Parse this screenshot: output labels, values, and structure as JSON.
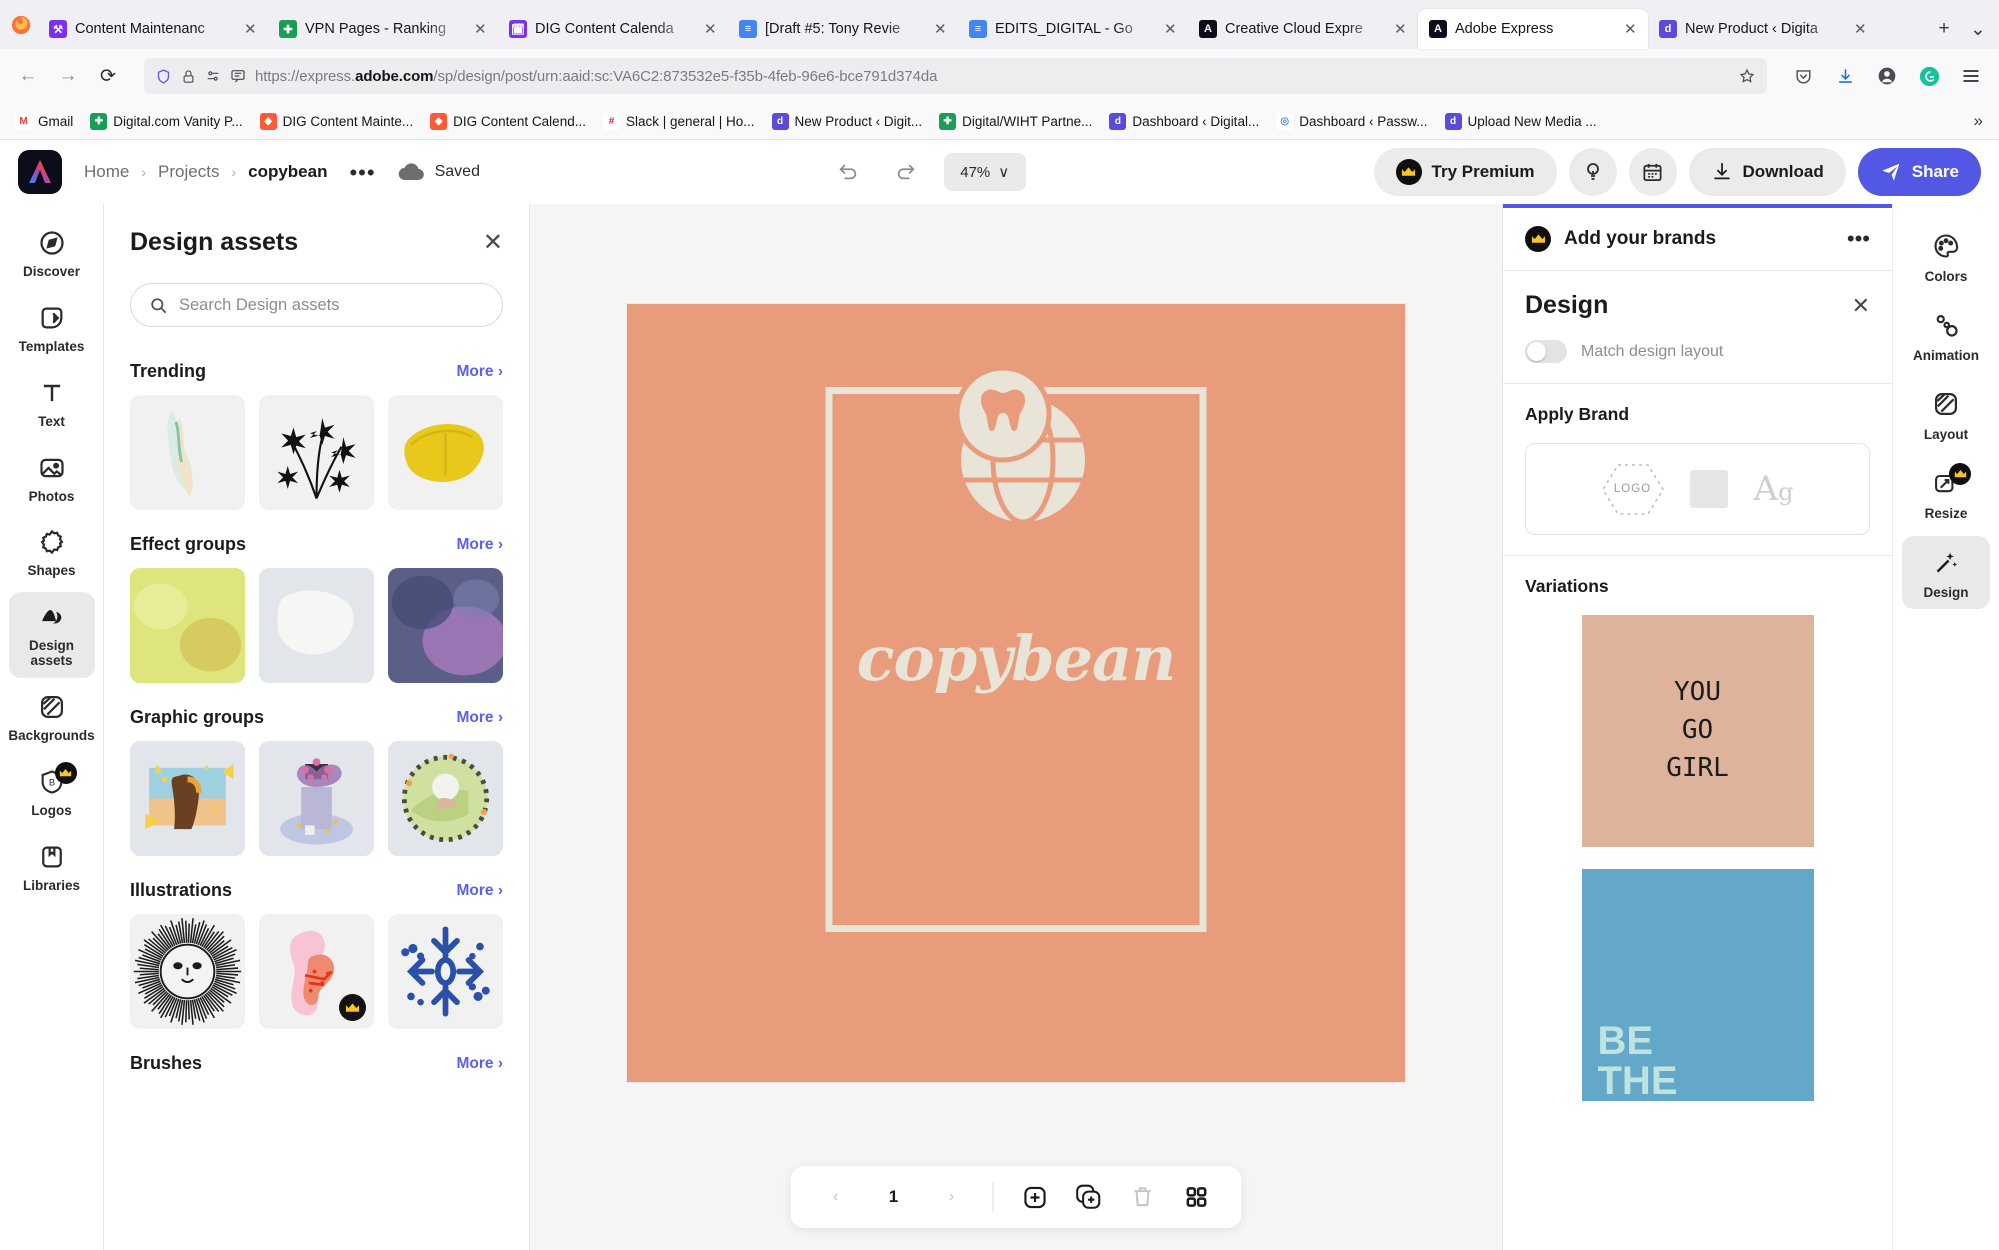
{
  "browser": {
    "tabs": [
      {
        "title": "Content Maintenanc",
        "favicon_color": "#7b2ff7",
        "favicon_glyph": "⚒",
        "active": false
      },
      {
        "title": "VPN Pages - Ranking",
        "favicon_color": "#1a9e55",
        "favicon_glyph": "✚",
        "active": false
      },
      {
        "title": "DIG Content Calenda",
        "favicon_color": "#7b2ff7",
        "favicon_glyph": "🗓",
        "active": false
      },
      {
        "title": "[Draft #5: Tony Revie",
        "favicon_color": "#4285f4",
        "favicon_glyph": "≡",
        "active": false
      },
      {
        "title": "EDITS_DIGITAL - Go",
        "favicon_color": "#4285f4",
        "favicon_glyph": "≡",
        "active": false
      },
      {
        "title": "Creative Cloud Expre",
        "favicon_color": "#0b0e1a",
        "favicon_glyph": "A",
        "active": false
      },
      {
        "title": "Adobe Express",
        "favicon_color": "#0b0e1a",
        "favicon_glyph": "A",
        "active": true
      },
      {
        "title": "New Product ‹ Digita",
        "favicon_color": "#5b4bdb",
        "favicon_glyph": "d",
        "active": false
      }
    ],
    "newtab_label": "+",
    "tablist_label": "⌄",
    "nav": {
      "back": "←",
      "forward": "→",
      "reload": "⟳"
    },
    "url": {
      "scheme": "https://express.",
      "host": "adobe.com",
      "path": "/sp/design/post/urn:aaid:sc:VA6C2:873532e5-f35b-4feb-96e6-bce791d374da"
    },
    "bookmarks": [
      {
        "label": "Gmail",
        "color": "#ffffff",
        "glyph": "M",
        "glyph_color": "#ea4335"
      },
      {
        "label": "Digital.com Vanity P...",
        "color": "#1a9e55",
        "glyph": "✚"
      },
      {
        "label": "DIG Content Mainte...",
        "color": "#ff5a36",
        "glyph": "◆"
      },
      {
        "label": "DIG Content Calend...",
        "color": "#ff5a36",
        "glyph": "◆"
      },
      {
        "label": "Slack | general | Ho...",
        "color": "#ffffff",
        "glyph": "#",
        "glyph_color": "#e01e5a"
      },
      {
        "label": "New Product ‹ Digit...",
        "color": "#5b4bdb",
        "glyph": "d"
      },
      {
        "label": "Digital/WIHT Partne...",
        "color": "#1a9e55",
        "glyph": "✚"
      },
      {
        "label": "Dashboard ‹ Digital...",
        "color": "#5b4bdb",
        "glyph": "d"
      },
      {
        "label": "Dashboard ‹ Passw...",
        "color": "#ffffff",
        "glyph": "◎",
        "glyph_color": "#4a90d9"
      },
      {
        "label": "Upload New Media ...",
        "color": "#5b4bdb",
        "glyph": "d"
      }
    ],
    "bookmarks_overflow": "»"
  },
  "app_header": {
    "breadcrumb": [
      "Home",
      "Projects",
      "copybean"
    ],
    "separator": "›",
    "more_dots": "•••",
    "save_status": "Saved",
    "undo_label": "↶",
    "redo_label": "↷",
    "zoom_value": "47%",
    "zoom_caret": "∨",
    "try_premium_label": "Try Premium",
    "download_label": "Download",
    "share_label": "Share"
  },
  "left_rail": {
    "items": [
      {
        "label": "Discover",
        "icon": "compass-icon",
        "active": false,
        "premium": false
      },
      {
        "label": "Templates",
        "icon": "templates-icon",
        "active": false,
        "premium": false
      },
      {
        "label": "Text",
        "icon": "text-icon",
        "active": false,
        "premium": false
      },
      {
        "label": "Photos",
        "icon": "photos-icon",
        "active": false,
        "premium": false
      },
      {
        "label": "Shapes",
        "icon": "shapes-icon",
        "active": false,
        "premium": false
      },
      {
        "label": "Design assets",
        "icon": "design-assets-icon",
        "active": true,
        "premium": false
      },
      {
        "label": "Backgrounds",
        "icon": "backgrounds-icon",
        "active": false,
        "premium": false
      },
      {
        "label": "Logos",
        "icon": "logos-icon",
        "active": false,
        "premium": true
      },
      {
        "label": "Libraries",
        "icon": "libraries-icon",
        "active": false,
        "premium": false
      }
    ]
  },
  "assets_panel": {
    "title": "Design assets",
    "close_label": "✕",
    "search_placeholder": "Search Design assets",
    "more_label": "More",
    "more_caret": "›",
    "sections": [
      {
        "title": "Trending",
        "thumbs": [
          "paint-smear-thumb",
          "black-flowers-thumb",
          "yellow-leaf-thumb"
        ]
      },
      {
        "title": "Effect groups",
        "thumbs": [
          "yellow-texture-thumb",
          "white-texture-thumb",
          "purple-texture-thumb"
        ]
      },
      {
        "title": "Graphic groups",
        "thumbs": [
          "woman-frame-thumb",
          "person-flowers-thumb",
          "circle-wreath-thumb"
        ]
      },
      {
        "title": "Illustrations",
        "thumbs": [
          "sun-face-thumb",
          "pink-blob-thumb",
          "snowflake-thumb"
        ]
      },
      {
        "title": "Brushes",
        "thumbs": []
      }
    ]
  },
  "canvas": {
    "background_color": "#e89c7c",
    "frame_color": "#e8e4d8",
    "brand_word": "copybean",
    "logo_name": "tooth-globe-logo",
    "page_toolbar": {
      "prev_label": "‹",
      "page_number": "1",
      "next_label": "›",
      "add_page_label": "⊕",
      "duplicate_page_label": "duplicate-icon",
      "delete_page_label": "trash-icon",
      "grid_view_label": "grid-icon"
    }
  },
  "right_panel": {
    "brand_banner": "Add your brands",
    "brand_dots": "•••",
    "design_title": "Design",
    "design_close": "✕",
    "match_layout_label": "Match design layout",
    "match_layout_on": false,
    "apply_brand_label": "Apply Brand",
    "brand_card": {
      "logo_placeholder": "LOGO",
      "swatch_color": "#e6e6e6",
      "type_sample": "Ag"
    },
    "variations_label": "Variations",
    "variations": [
      {
        "name": "you-go-girl-variation",
        "bg": "#ddb49b",
        "lines": [
          "YOU",
          "GO",
          "GIRL"
        ]
      },
      {
        "name": "be-the-variation",
        "bg": "#63a8c8",
        "lines": [
          "BE",
          "THE"
        ]
      }
    ]
  },
  "right_rail": {
    "items": [
      {
        "label": "Colors",
        "icon": "palette-icon",
        "active": false,
        "premium": false
      },
      {
        "label": "Animation",
        "icon": "animation-icon",
        "active": false,
        "premium": false
      },
      {
        "label": "Layout",
        "icon": "layout-icon",
        "active": false,
        "premium": false
      },
      {
        "label": "Resize",
        "icon": "resize-icon",
        "active": false,
        "premium": true
      },
      {
        "label": "Design",
        "icon": "magic-wand-icon",
        "active": true,
        "premium": false
      }
    ]
  }
}
